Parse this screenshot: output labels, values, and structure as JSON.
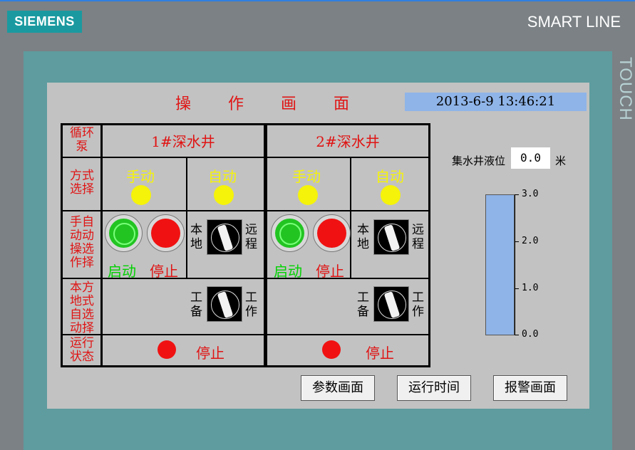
{
  "device": {
    "brand": "SIEMENS",
    "model": "SMART LINE",
    "bezel_text": "TOUCH"
  },
  "screen": {
    "title": [
      "操",
      "作",
      "画",
      "面"
    ],
    "datetime": "2013-6-9 13:46:21"
  },
  "row_labels": {
    "pump": "循环\n泵",
    "mode": "方式\n选择",
    "manual_auto": "手自\n动动\n操选\n作择",
    "local_mode": "本方\n地式\n自选\n动择",
    "run_status": "运行\n状态"
  },
  "wells": [
    {
      "title": "1#深水井",
      "manual": "手动",
      "auto": "自动",
      "start": "启动",
      "stop": "停止",
      "local": "本地",
      "remote": "远程",
      "standby": "工备",
      "work": "工作",
      "status": "停止"
    },
    {
      "title": "2#深水井",
      "manual": "手动",
      "auto": "自动",
      "start": "启动",
      "stop": "停止",
      "local": "本地",
      "remote": "远程",
      "standby": "工备",
      "work": "工作",
      "status": "停止"
    }
  ],
  "level": {
    "label": "集水井液位",
    "value": "0.0",
    "unit": "米",
    "scale": [
      "3.0",
      "2.0",
      "1.0",
      "0.0"
    ]
  },
  "nav": {
    "params": "参数画面",
    "runtime": "运行时间",
    "alarm": "报警画面"
  },
  "colors": {
    "title_red": "#e01414",
    "lamp_yellow": "#f5f30a",
    "start_green": "#22c422",
    "stop_red": "#f01212",
    "datetime_bg": "#8fb4e8"
  }
}
